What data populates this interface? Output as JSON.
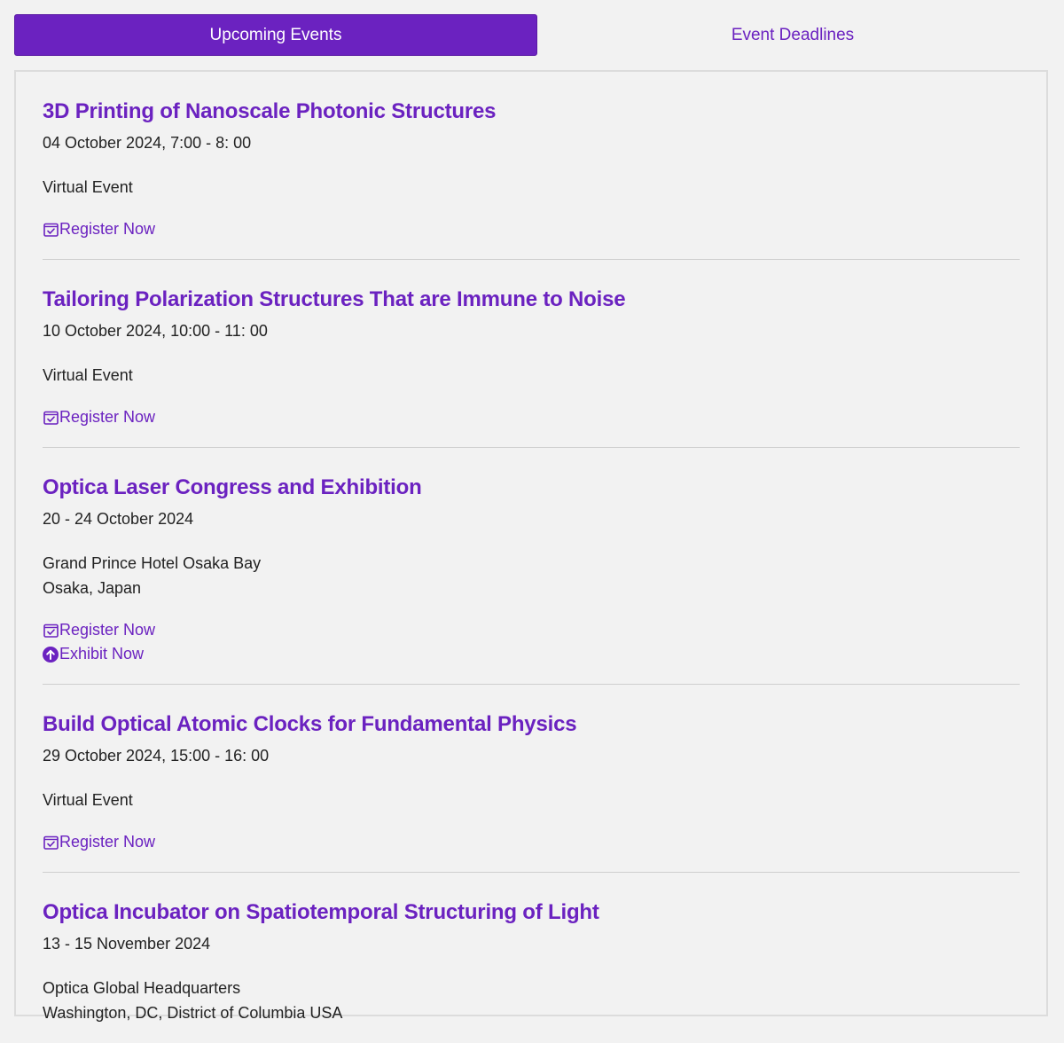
{
  "tabs": [
    {
      "label": "Upcoming Events",
      "active": true
    },
    {
      "label": "Event Deadlines",
      "active": false
    }
  ],
  "colors": {
    "accent": "#6b22c0",
    "text": "#222222",
    "background": "#f2f2f2"
  },
  "events": [
    {
      "title": "3D Printing of Nanoscale Photonic Structures",
      "date": "04 October 2024, 7:00 - 8: 00",
      "location": [
        "Virtual Event"
      ],
      "links": [
        {
          "icon": "calendar-check-icon",
          "label": "Register Now"
        }
      ]
    },
    {
      "title": "Tailoring Polarization Structures That are Immune to Noise",
      "date": "10 October 2024, 10:00 - 11: 00",
      "location": [
        "Virtual Event"
      ],
      "links": [
        {
          "icon": "calendar-check-icon",
          "label": "Register Now"
        }
      ]
    },
    {
      "title": "Optica Laser Congress and Exhibition",
      "date": "20 - 24 October 2024",
      "location": [
        "Grand Prince Hotel Osaka Bay",
        "Osaka, Japan"
      ],
      "links": [
        {
          "icon": "calendar-check-icon",
          "label": "Register Now"
        },
        {
          "icon": "arrow-up-circle-icon",
          "label": "Exhibit Now"
        }
      ]
    },
    {
      "title": "Build Optical Atomic Clocks for Fundamental Physics",
      "date": "29 October 2024, 15:00 - 16: 00",
      "location": [
        "Virtual Event"
      ],
      "links": [
        {
          "icon": "calendar-check-icon",
          "label": "Register Now"
        }
      ]
    },
    {
      "title": "Optica Incubator on Spatiotemporal Structuring of Light",
      "date": "13 - 15 November 2024",
      "location": [
        "Optica Global Headquarters",
        "Washington, DC, District of Columbia USA"
      ],
      "links": []
    }
  ]
}
